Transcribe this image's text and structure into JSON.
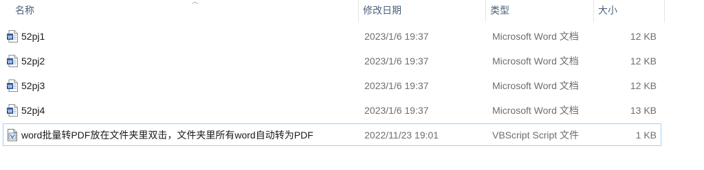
{
  "columns": {
    "name": "名称",
    "date": "修改日期",
    "type": "类型",
    "size": "大小"
  },
  "files": [
    {
      "name": "52pj1",
      "date": "2023/1/6 19:37",
      "type": "Microsoft Word 文档",
      "size": "12 KB",
      "icon": "word-document-icon"
    },
    {
      "name": "52pj2",
      "date": "2023/1/6 19:37",
      "type": "Microsoft Word 文档",
      "size": "12 KB",
      "icon": "word-document-icon"
    },
    {
      "name": "52pj3",
      "date": "2023/1/6 19:37",
      "type": "Microsoft Word 文档",
      "size": "12 KB",
      "icon": "word-document-icon"
    },
    {
      "name": "52pj4",
      "date": "2023/1/6 19:37",
      "type": "Microsoft Word 文档",
      "size": "13 KB",
      "icon": "word-document-icon"
    },
    {
      "name": "word批量转PDF放在文件夹里双击，文件夹里所有word自动转为PDF",
      "date": "2022/11/23 19:01",
      "type": "VBScript Script 文件",
      "size": "1 KB",
      "icon": "vbscript-file-icon"
    }
  ],
  "colors": {
    "header_text": "#4c607a",
    "detail_text": "#6d6d6d",
    "word_blue": "#2b579a",
    "focus_outline": "#99d1ff"
  }
}
